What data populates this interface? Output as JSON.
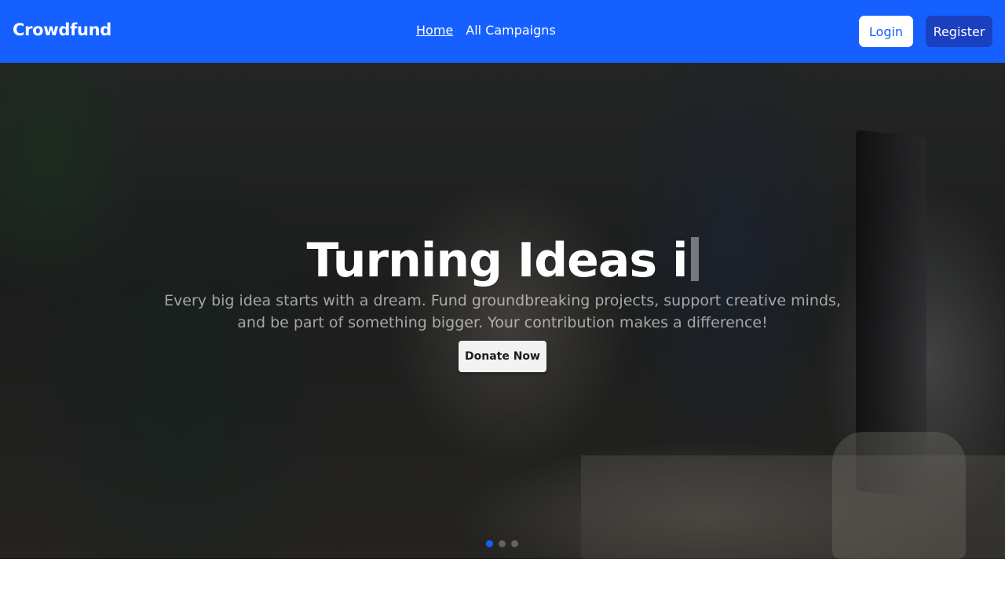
{
  "navbar": {
    "brand": "Crowdfund",
    "links": [
      {
        "label": "Home",
        "active": true
      },
      {
        "label": "All Campaigns",
        "active": false
      }
    ],
    "login_label": "Login",
    "register_label": "Register"
  },
  "hero": {
    "title": "Turning Ideas i",
    "subtitle": "Every big idea starts with a dream. Fund groundbreaking projects, support creative minds, and be part of something bigger. Your contribution makes a difference!",
    "cta_label": "Donate Now",
    "slides": {
      "count": 3,
      "active_index": 0
    }
  },
  "colors": {
    "brand_blue": "#1660ff",
    "register_bg": "#1a3fbf"
  }
}
